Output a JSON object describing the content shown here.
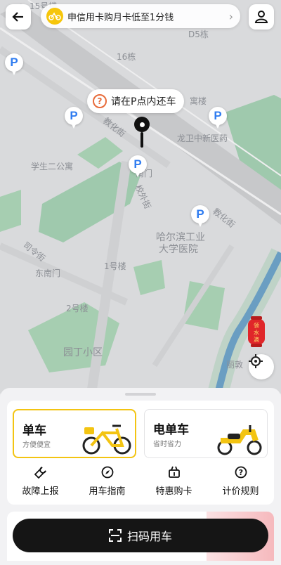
{
  "header": {
    "back_icon": "arrow-left-icon",
    "promo_text": "申信用卡购月卡低至1分钱",
    "promo_icon": "bike-icon",
    "profile_icon": "person-icon"
  },
  "map": {
    "tip_text": "请在P点内还车",
    "tip_icon": "question-icon",
    "parking_symbol": "P",
    "labels": {
      "d5": "D5栋",
      "b16": "16栋",
      "top_small": "15号楼",
      "street_top": "教化街",
      "street_right": "教化街",
      "hospital_short": "龙卫中新医药",
      "xuesheng": "学生二公寓",
      "menmen": "南门",
      "xiaowai": "校外街",
      "hospital_line1": "哈尔滨工业",
      "hospital_line2": "大学医院",
      "siling": "司令街",
      "dongnanmen": "东南门",
      "b1": "1号楼",
      "b2": "2号楼",
      "garden": "园丁小区",
      "lijing": "丽敦",
      "building": "寓楼"
    },
    "water_badge": "领水滴",
    "locate_icon": "crosshair-icon"
  },
  "bottom_sheet": {
    "cards": [
      {
        "title": "单车",
        "subtitle": "方便便宜",
        "selected": true
      },
      {
        "title": "电单车",
        "subtitle": "省时省力",
        "selected": false
      }
    ],
    "actions": [
      {
        "label": "故障上报",
        "icon": "wrench-icon"
      },
      {
        "label": "用车指南",
        "icon": "compass-icon"
      },
      {
        "label": "特惠购卡",
        "icon": "basket-icon"
      },
      {
        "label": "计价规则",
        "icon": "question-circle-icon"
      }
    ],
    "scan_button": "扫码用车",
    "scan_icon": "scan-icon"
  },
  "colors": {
    "accent": "#f3c412",
    "parking_blue": "#2f7cf0",
    "button_dark": "#151515",
    "river": "#3f7bd3",
    "green_area": "#9fc9ad"
  }
}
